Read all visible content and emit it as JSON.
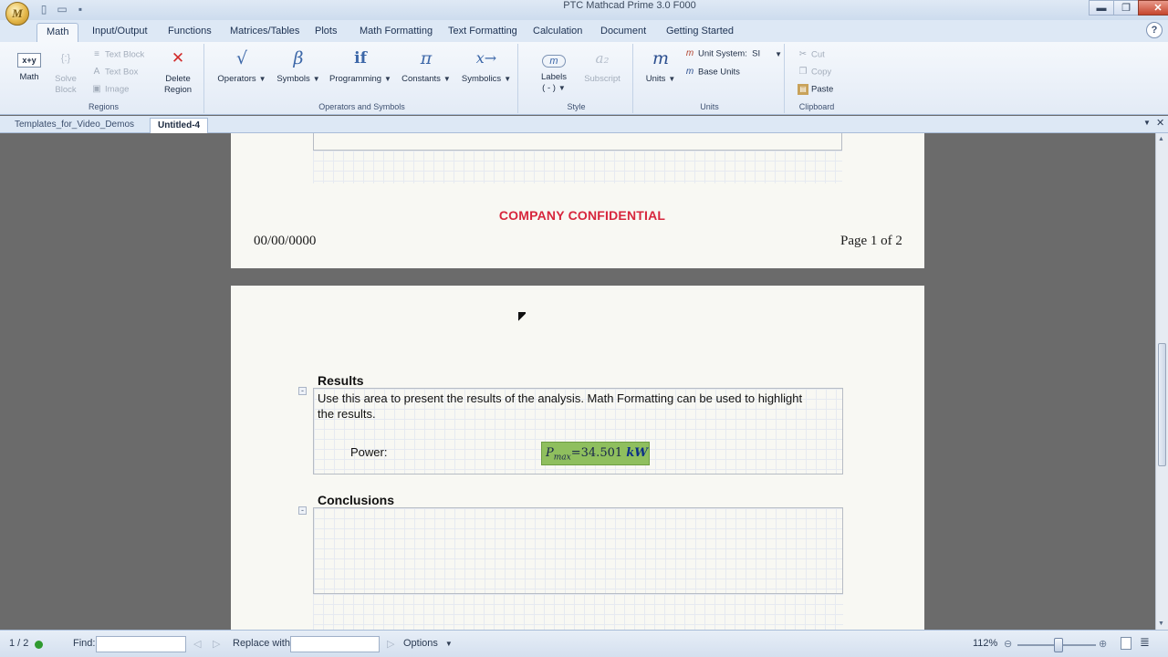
{
  "app": {
    "title": "PTC Mathcad Prime 3.0 F000",
    "orb_label": "M",
    "window_controls": {
      "minimize": "▬",
      "restore": "❐",
      "close": "✕"
    },
    "help": "?"
  },
  "qat": {
    "new_icon": "new-document-icon",
    "open_icon": "open-folder-icon",
    "save_icon": "save-icon"
  },
  "ribbon_tabs": [
    "Math",
    "Input/Output",
    "Functions",
    "Matrices/Tables",
    "Plots",
    "Math Formatting",
    "Text Formatting",
    "Calculation",
    "Document",
    "Getting Started"
  ],
  "ribbon": {
    "regions": {
      "math": "Math",
      "solve_block": [
        "Solve",
        "Block"
      ],
      "text_block": "Text Block",
      "text_box": "Text Box",
      "image": "Image",
      "delete_region": [
        "Delete",
        "Region"
      ],
      "group_label": "Regions"
    },
    "operators": {
      "operators": "Operators",
      "symbols": "Symbols",
      "programming": "Programming",
      "constants": "Constants",
      "symbolics": "Symbolics",
      "group_label": "Operators and Symbols"
    },
    "style": {
      "labels": "Labels",
      "labels_value": "( - )",
      "subscript": "Subscript",
      "group_label": "Style"
    },
    "units": {
      "units": "Units",
      "unit_system_label": "Unit System:",
      "unit_system_value": "SI",
      "base_units": "Base Units",
      "group_label": "Units"
    },
    "clipboard": {
      "cut": "Cut",
      "copy": "Copy",
      "paste": "Paste",
      "group_label": "Clipboard"
    }
  },
  "document_tabs": [
    "Templates_for_Video_Demos",
    "Untitled-4"
  ],
  "page1": {
    "confidential": "COMPANY CONFIDENTIAL",
    "date": "00/00/0000",
    "page_number": "Page 1 of 2"
  },
  "page2": {
    "results_heading": "Results",
    "results_text_line1": "Use this area to present the results of the analysis. Math Formatting can be used to highlight",
    "results_text_line2": "the results.",
    "power_label": "Power:",
    "math": {
      "var": "P",
      "sub": "max",
      "eq": "=",
      "value": "34.501",
      "unit": "kW"
    },
    "conclusions_heading": "Conclusions"
  },
  "statusbar": {
    "page_indicator": "1 / 2",
    "find_label": "Find:",
    "find_value": "",
    "replace_label": "Replace with:",
    "replace_value": "",
    "options": "Options",
    "zoom": "112%"
  }
}
